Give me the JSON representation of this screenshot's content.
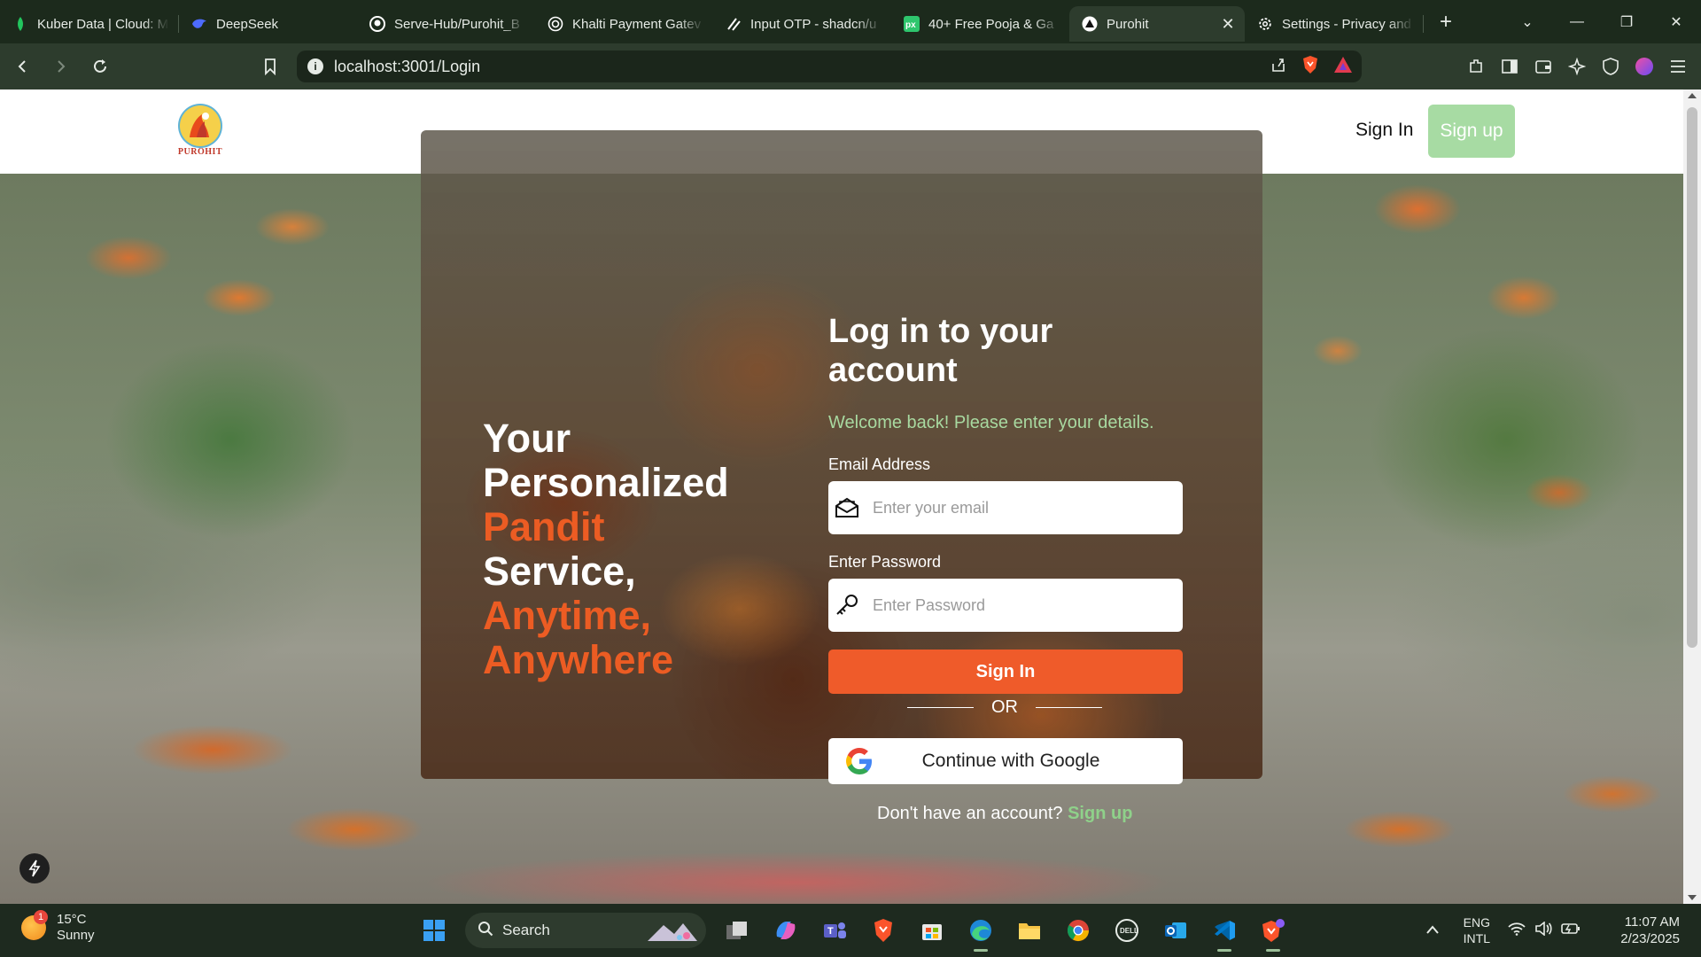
{
  "browser": {
    "tabs": [
      {
        "label": "Kuber Data | Cloud: M",
        "icon": "kuber-icon",
        "color": "#22c55e"
      },
      {
        "label": "DeepSeek",
        "icon": "deepseek-icon",
        "color": "#4d6bfe"
      },
      {
        "label": "Serve-Hub/Purohit_B",
        "icon": "github-icon",
        "color": "#ffffff"
      },
      {
        "label": "Khalti Payment Gatev",
        "icon": "khalti-icon",
        "color": "#ffffff"
      },
      {
        "label": "Input OTP - shadcn/u",
        "icon": "shadcn-icon",
        "color": "#ffffff"
      },
      {
        "label": "40+ Free Pooja & Ga",
        "icon": "pixabay-icon",
        "color": "#2ec66d"
      },
      {
        "label": "Purohit",
        "icon": "purohit-favicon",
        "color": "#ffffff",
        "active": true
      },
      {
        "label": "Settings - Privacy and",
        "icon": "gear-icon",
        "color": "#ffffff"
      }
    ],
    "url": "localhost:3001/Login"
  },
  "header": {
    "logo_text": "PUROHIT",
    "signin_label": "Sign In",
    "signup_label": "Sign up"
  },
  "hero": {
    "tagline": [
      {
        "text": "Your",
        "accent": false
      },
      {
        "text": "Personalized",
        "accent": false
      },
      {
        "text": "Pandit",
        "accent": true
      },
      {
        "text": "Service,",
        "accent": false
      },
      {
        "text": "Anytime,",
        "accent": true
      },
      {
        "text": "Anywhere",
        "accent": true
      }
    ]
  },
  "login": {
    "title": "Log in to your account",
    "subtitle": "Welcome back! Please enter your details.",
    "email_label": "Email Address",
    "email_placeholder": "Enter your email",
    "email_value": "",
    "password_label": "Enter Password",
    "password_placeholder": "Enter Password",
    "password_value": "",
    "submit_label": "Sign In",
    "or_text": "OR",
    "google_label": "Continue with Google",
    "signup_prompt": "Don't have an account?",
    "signup_link": "Sign up"
  },
  "colors": {
    "accent_orange": "#ec5c23",
    "button_orange": "#ef5b2a",
    "signup_green": "#a7dba3",
    "subtitle_green": "#a8d9a0"
  },
  "taskbar": {
    "weather_temp": "15°C",
    "weather_desc": "Sunny",
    "weather_badge": "1",
    "search_label": "Search",
    "lang_line1": "ENG",
    "lang_line2": "INTL",
    "time": "11:07 AM",
    "date": "2/23/2025",
    "apps": [
      "task-view-icon",
      "copilot-icon",
      "teams-icon",
      "brave-icon",
      "store-icon",
      "edge-icon",
      "file-explorer-icon",
      "chrome-icon",
      "dell-icon",
      "outlook-icon",
      "vscode-icon",
      "brave-nightly-icon"
    ]
  }
}
